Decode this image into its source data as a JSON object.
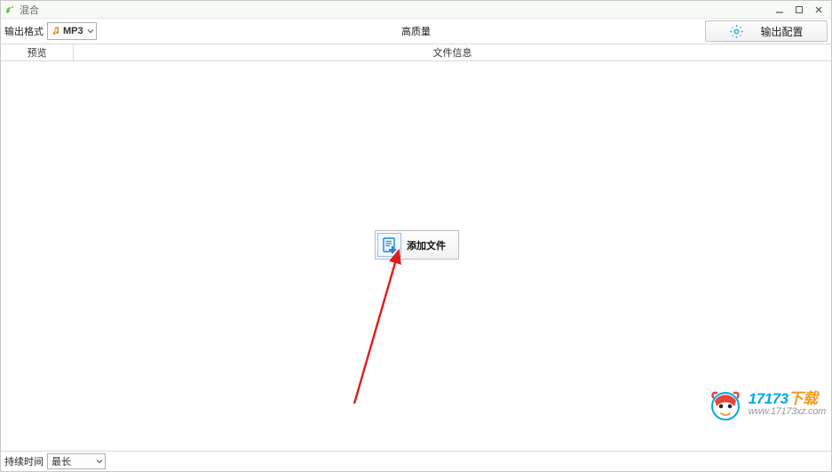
{
  "window": {
    "title": "混合"
  },
  "toolbar": {
    "format_label": "输出格式",
    "format_value": "MP3",
    "quality": "高质量",
    "output_config": "输出配置"
  },
  "tabs": {
    "preview": "预览",
    "info": "文件信息"
  },
  "main": {
    "add_file": "添加文件"
  },
  "bottom": {
    "duration_label": "持续时间",
    "duration_value": "最长"
  },
  "watermark": {
    "brand_prefix": "17173",
    "brand_suffix": "下载",
    "url": "www.17173xz.com"
  }
}
